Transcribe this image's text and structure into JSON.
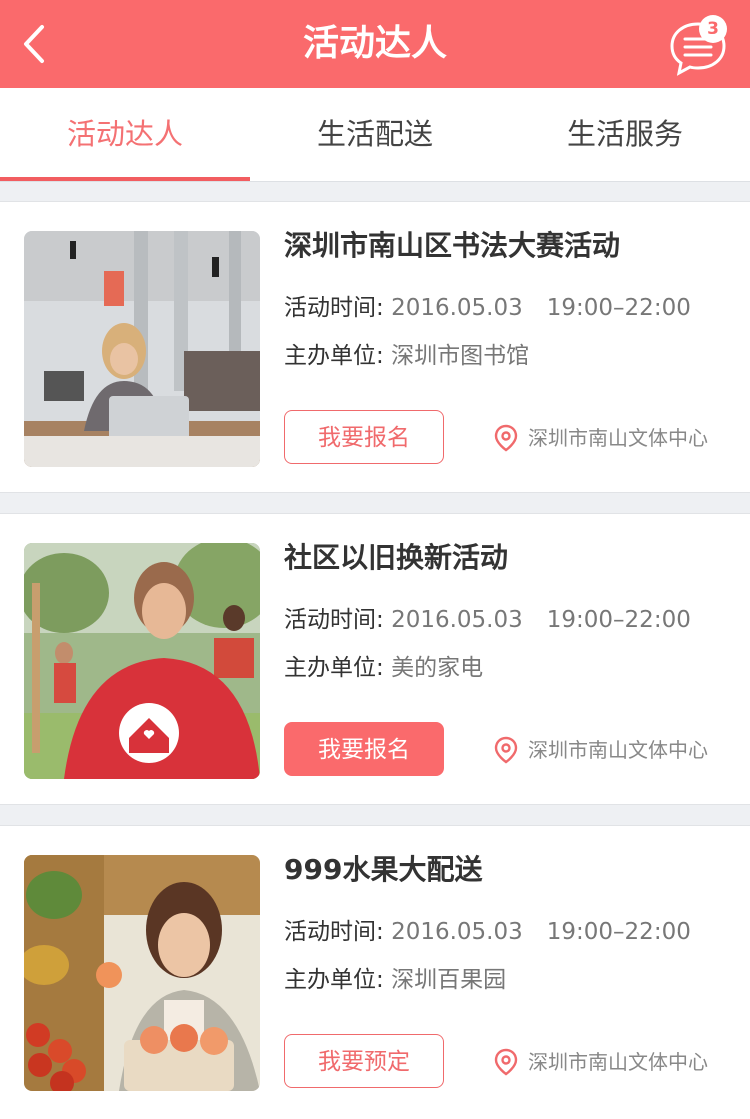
{
  "header": {
    "title": "活动达人",
    "back_icon": "chevron-left-icon",
    "message_icon": "message-list-icon",
    "badge_count": "3",
    "accent_color": "#fa6a6c"
  },
  "tabs": [
    {
      "label": "活动达人",
      "active": true
    },
    {
      "label": "生活配送",
      "active": false
    },
    {
      "label": "生活服务",
      "active": false
    }
  ],
  "events": [
    {
      "title": "深圳市南山区书法大赛活动",
      "time_label": "活动时间:",
      "date": "2016.05.03",
      "time": "19:00–22:00",
      "org_label": "主办单位:",
      "organizer": "深圳市图书馆",
      "button": "我要报名",
      "button_style": "outline",
      "location": "深圳市南山文体中心",
      "image": "woman-with-laptop-in-library"
    },
    {
      "title": "社区以旧换新活动",
      "time_label": "活动时间:",
      "date": "2016.05.03",
      "time": "19:00–22:00",
      "org_label": "主办单位:",
      "organizer": "美的家电",
      "button": "我要报名",
      "button_style": "filled",
      "location": "深圳市南山文体中心",
      "image": "volunteer-woman-red-shirt"
    },
    {
      "title": "999水果大配送",
      "time_label": "活动时间:",
      "date": "2016.05.03",
      "time": "19:00–22:00",
      "org_label": "主办单位:",
      "organizer": "深圳百果园",
      "button": "我要预定",
      "button_style": "outline",
      "location": "深圳市南山文体中心",
      "image": "woman-holding-peach-fruit-stand"
    }
  ]
}
